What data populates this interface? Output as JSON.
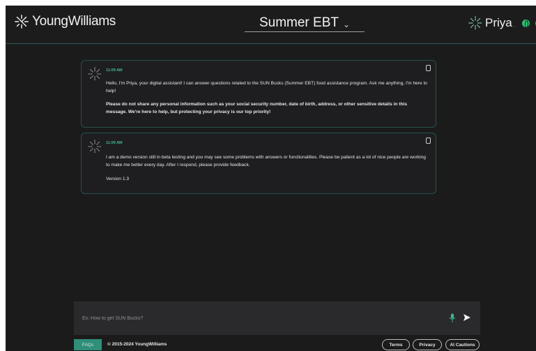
{
  "header": {
    "brand": "YoungWilliams",
    "title": "Summer EBT",
    "title_chevron": "⌄",
    "assistant_name": "Priya",
    "assistant_suffix": "."
  },
  "messages": [
    {
      "time": "11:09 AM",
      "paragraphs": [
        "Hello, I'm Priya, your digital assistant! I can answer questions related to the SUN Bucks (Summer EBT) food assistance program. Ask me anything, I'm here to help!",
        "Please do not share any personal information such as your social security number, date of birth, address, or other sensitive details in this message. We're here to help, but protecting your privacy is our top priority!"
      ]
    },
    {
      "time": "11:09 AM",
      "paragraphs": [
        "I am a demo version still in beta testing and you may see some problems with answers or functionalities. Please be patient as a lot of nice people are working to make me better every day. After I respond, please provide feedback.",
        "Version 1.3"
      ]
    }
  ],
  "input": {
    "placeholder": "Ex: How to get SUN Bucks?",
    "value": ""
  },
  "footer": {
    "faq_label": "FAQs",
    "copyright": "© 2015-2024 YoungWilliams",
    "terms_label": "Terms",
    "privacy_label": "Privacy",
    "ai_cautions_label": "AI Cautions"
  },
  "colors": {
    "background": "#1b1b1c",
    "accent": "#2f8f79",
    "time_text": "#3fb89a",
    "border": "#28504c",
    "status_green": "#2fbf73"
  },
  "icons": {
    "logo": "sparkle-logo-icon",
    "copy": "copy-icon",
    "mic": "microphone-icon",
    "send": "send-icon",
    "language": "globe-icon"
  }
}
